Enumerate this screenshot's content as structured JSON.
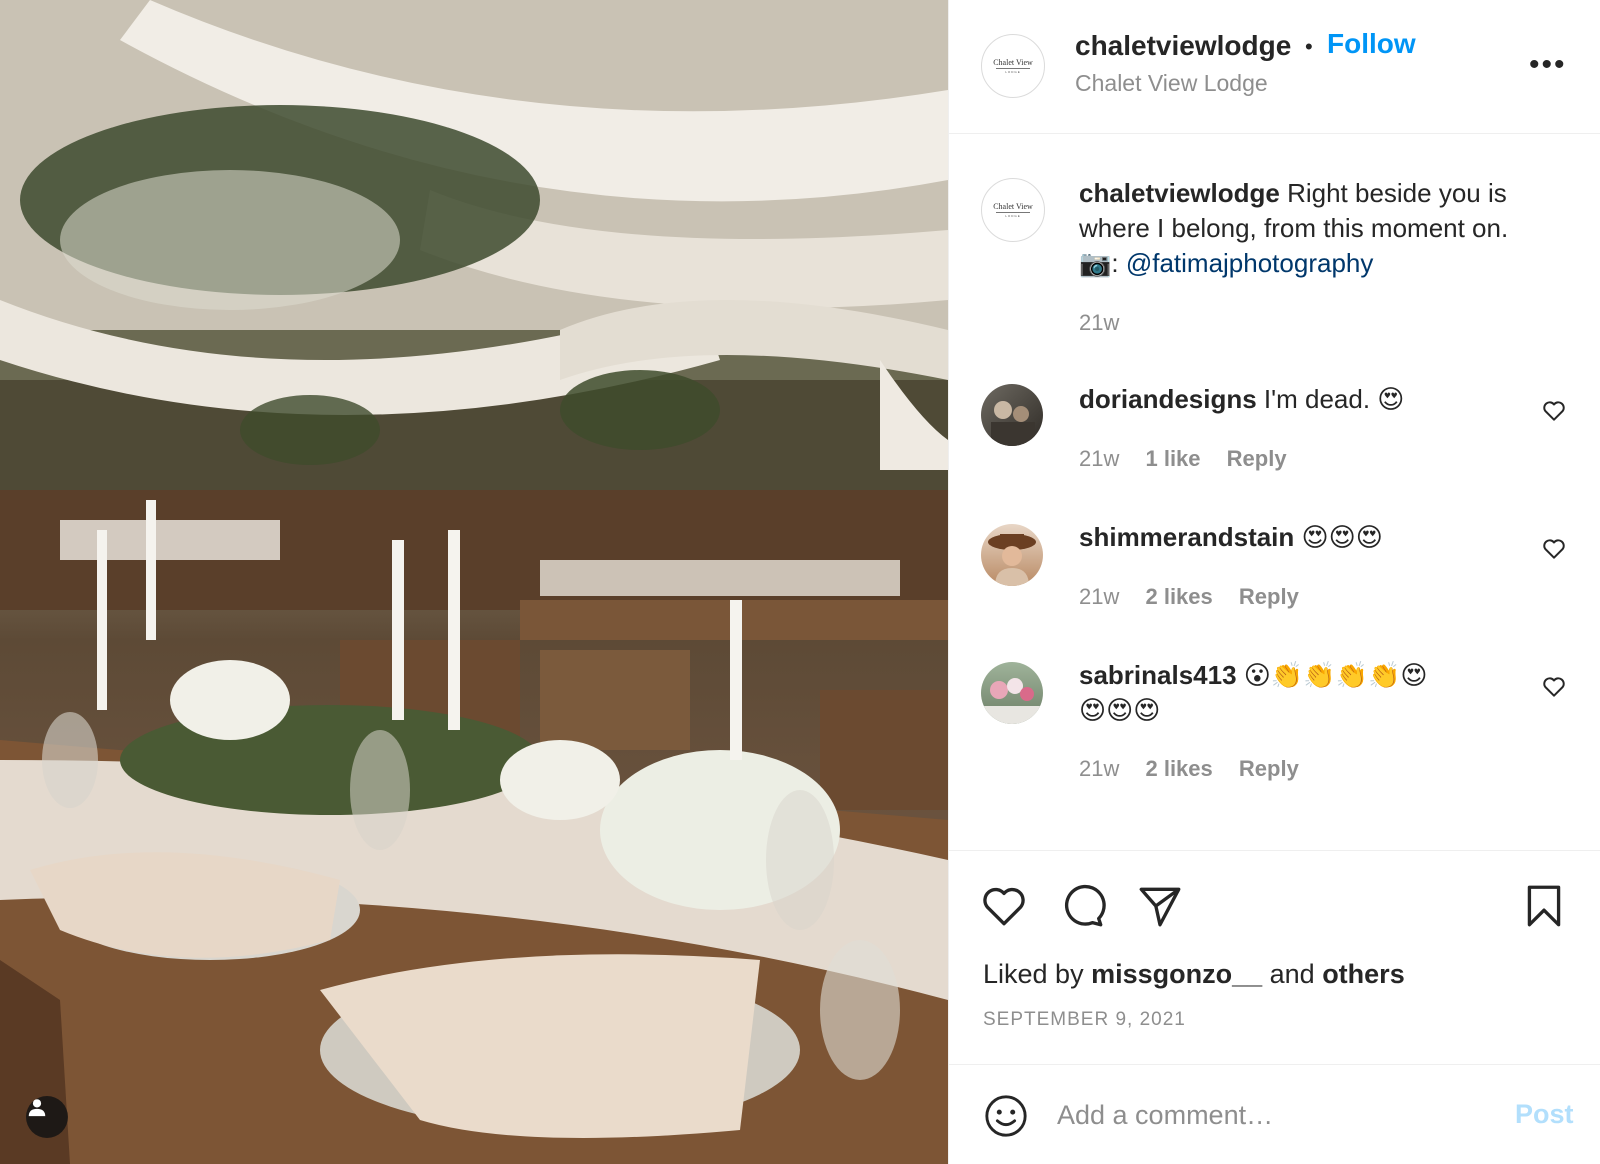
{
  "photo": {
    "alt_icon": "user-tag-icon"
  },
  "header": {
    "username": "chaletviewlodge",
    "separator": "•",
    "follow_label": "Follow",
    "subtitle": "Chalet View Lodge",
    "more_label": "•••",
    "avatar_logo": "Chalet View",
    "avatar_logo_sub": "LODGE"
  },
  "caption": {
    "username": "chaletviewlodge",
    "text_line1": " Right beside you is",
    "text_line2": "where I belong, from this moment on.",
    "camera": "📷",
    "colon": ": ",
    "mention": "@fatimajphotography",
    "age": "21w"
  },
  "comments": [
    {
      "username": "doriandesigns",
      "text": " I'm dead. 😍",
      "age": "21w",
      "likes": "1 like",
      "reply": "Reply"
    },
    {
      "username": "shimmerandstain",
      "text": " 😍😍😍",
      "age": "21w",
      "likes": "2 likes",
      "reply": "Reply"
    },
    {
      "username": "sabrinals413",
      "text": " 😮👏👏👏👏😍",
      "text2": "😍😍😍",
      "age": "21w",
      "likes": "2 likes",
      "reply": "Reply"
    }
  ],
  "liked_by": {
    "prefix": "Liked by ",
    "user": "missgonzo__",
    "middle": " and ",
    "others": "others"
  },
  "date": "SEPTEMBER 9, 2021",
  "add_comment": {
    "placeholder": "Add a comment…",
    "post_label": "Post"
  },
  "colors": {
    "follow": "#0095f6",
    "post_disabled": "#b2dffc",
    "mention": "#00376b",
    "muted": "#8e8e8e"
  }
}
